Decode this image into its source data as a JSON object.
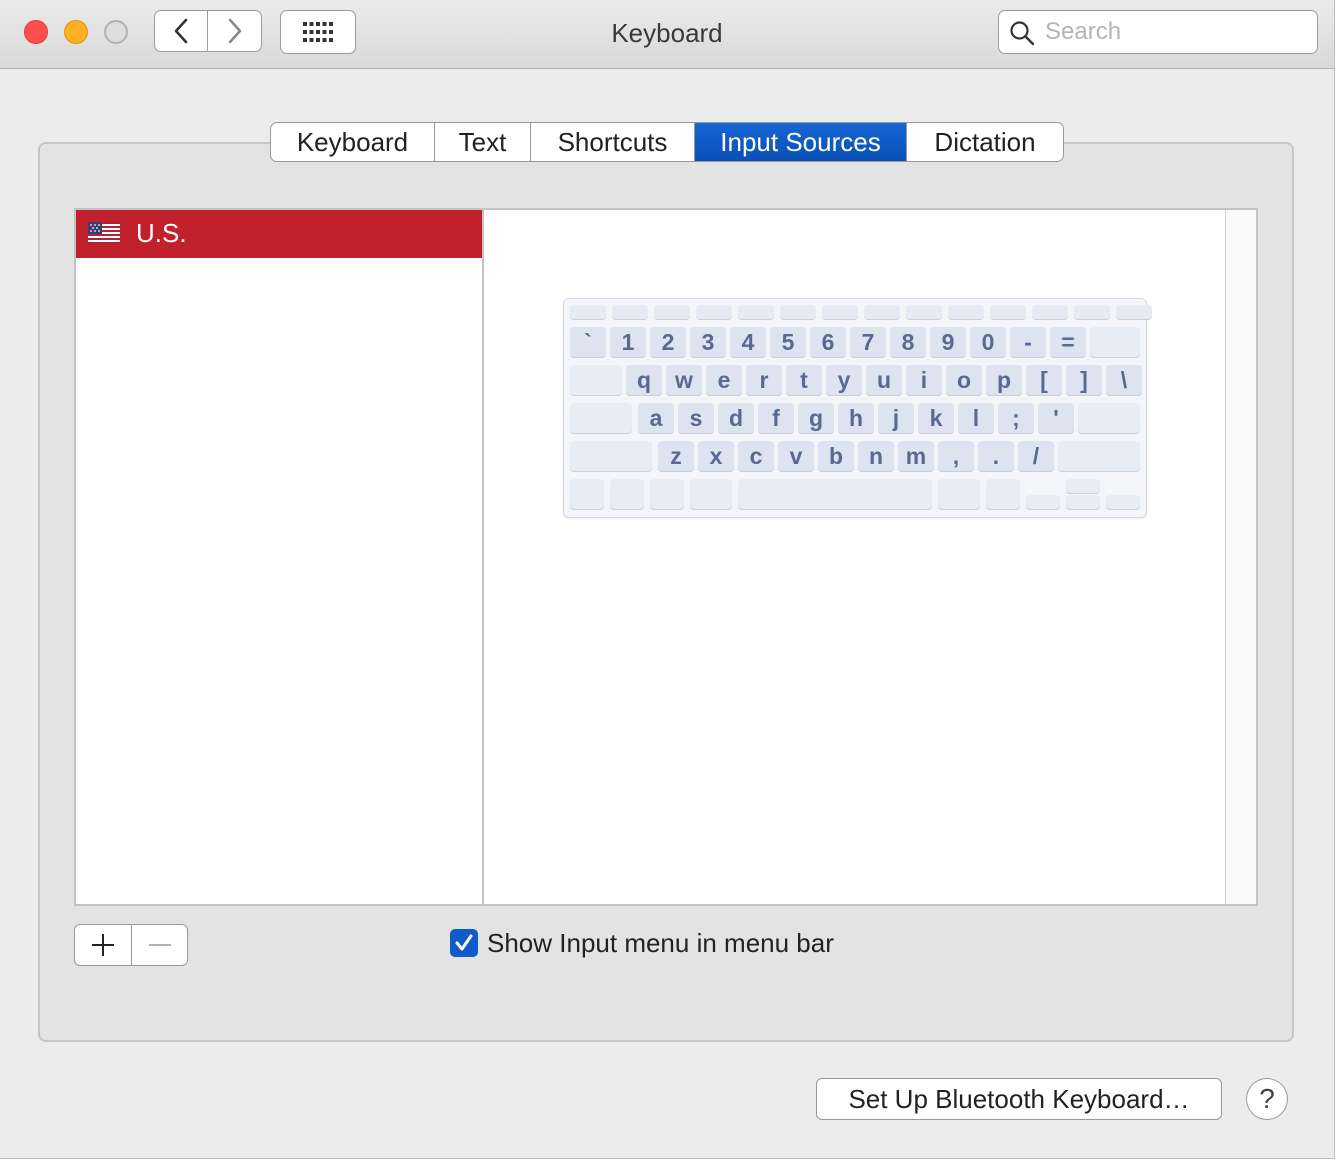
{
  "window": {
    "title": "Keyboard"
  },
  "search": {
    "placeholder": "Search"
  },
  "tabs": [
    {
      "label": "Keyboard",
      "active": false
    },
    {
      "label": "Text",
      "active": false
    },
    {
      "label": "Shortcuts",
      "active": false
    },
    {
      "label": "Input Sources",
      "active": true
    },
    {
      "label": "Dictation",
      "active": false
    }
  ],
  "input_sources": {
    "items": [
      {
        "label": "U.S.",
        "selected": true,
        "icon": "us-flag-icon"
      }
    ]
  },
  "keyboard_preview": {
    "rows": [
      [
        "`",
        "1",
        "2",
        "3",
        "4",
        "5",
        "6",
        "7",
        "8",
        "9",
        "0",
        "-",
        "="
      ],
      [
        "q",
        "w",
        "e",
        "r",
        "t",
        "y",
        "u",
        "i",
        "o",
        "p",
        "[",
        "]",
        "\\"
      ],
      [
        "a",
        "s",
        "d",
        "f",
        "g",
        "h",
        "j",
        "k",
        "l",
        ";",
        "'"
      ],
      [
        "z",
        "x",
        "c",
        "v",
        "b",
        "n",
        "m",
        ",",
        ".",
        "/"
      ]
    ]
  },
  "list_controls": {
    "add_icon": "plus-icon",
    "remove_icon": "minus-icon"
  },
  "show_input_menu": {
    "checked": true,
    "label": "Show Input menu in menu bar"
  },
  "footer": {
    "bluetooth_button": "Set Up Bluetooth Keyboard…",
    "help_label": "?"
  },
  "colors": {
    "accent": "#0f5bc7",
    "selection": "#c1202d",
    "key_text": "#586a94"
  }
}
